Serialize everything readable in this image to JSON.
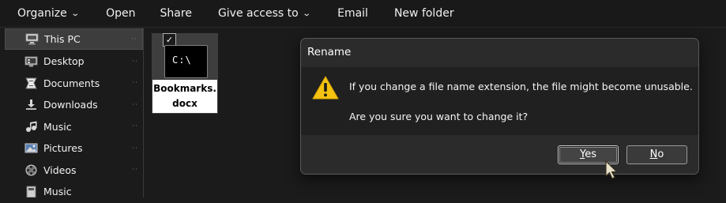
{
  "toolbar": {
    "organize": "Organize",
    "open": "Open",
    "share": "Share",
    "give_access": "Give access to",
    "email": "Email",
    "new_folder": "New folder"
  },
  "sidebar": {
    "items": [
      {
        "label": "This PC",
        "icon": "computer-icon"
      },
      {
        "label": "Desktop",
        "icon": "desktop-icon"
      },
      {
        "label": "Documents",
        "icon": "documents-icon"
      },
      {
        "label": "Downloads",
        "icon": "downloads-icon"
      },
      {
        "label": "Music",
        "icon": "music-icon"
      },
      {
        "label": "Pictures",
        "icon": "pictures-icon"
      },
      {
        "label": "Videos",
        "icon": "videos-icon"
      },
      {
        "label": "Music",
        "icon": "music-drive-icon"
      }
    ]
  },
  "file": {
    "name": "Bookmarks.docx",
    "icon_text": "C:\\",
    "selected": true
  },
  "dialog": {
    "title": "Rename",
    "message": "If you change a file name extension, the file might become unusable.",
    "question": "Are you sure you want to change it?",
    "yes_mnemonic": "Y",
    "yes_rest": "es",
    "no_mnemonic": "N",
    "no_rest": "o"
  },
  "colors": {
    "warning": "#f5c211",
    "background": "#1b1b1b",
    "dialog": "#2b2b2b"
  }
}
